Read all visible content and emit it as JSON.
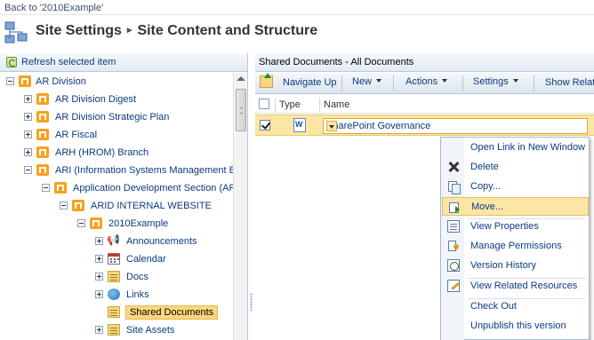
{
  "top_bar": {
    "back_link": "Back to '2010Example'"
  },
  "title": {
    "part1": "Site Settings",
    "separator": "▸",
    "part2": "Site Content and Structure"
  },
  "left_panel": {
    "refresh_label": "Refresh selected item",
    "tree": [
      {
        "label": "AR Division",
        "icon": "site-icon",
        "expander": "minus"
      },
      {
        "label": "AR Division Digest",
        "icon": "site-icon",
        "expander": "plus"
      },
      {
        "label": "AR Division Strategic Plan",
        "icon": "site-icon",
        "expander": "plus"
      },
      {
        "label": "AR Fiscal",
        "icon": "site-icon",
        "expander": "plus"
      },
      {
        "label": "ARH (HROM) Branch",
        "icon": "site-icon",
        "expander": "plus"
      },
      {
        "label": "ARI (Information Systems Management B",
        "icon": "site-icon",
        "expander": "minus"
      },
      {
        "label": "Application Development Section (AR",
        "icon": "site-icon",
        "expander": "minus"
      },
      {
        "label": "ARID INTERNAL WEBSITE",
        "icon": "site-icon",
        "expander": "minus"
      },
      {
        "label": "2010Example",
        "icon": "site-icon",
        "expander": "minus"
      },
      {
        "label": "Announcements",
        "icon": "megaphone-icon",
        "expander": "plus"
      },
      {
        "label": "Calendar",
        "icon": "calendar-icon",
        "expander": "plus"
      },
      {
        "label": "Docs",
        "icon": "folder-icon",
        "expander": "plus"
      },
      {
        "label": "Links",
        "icon": "globe-icon",
        "expander": "plus"
      },
      {
        "label": "Shared Documents",
        "icon": "folder-icon",
        "expander": "none",
        "selected": true
      },
      {
        "label": "Site Assets",
        "icon": "folder-icon",
        "expander": "plus"
      }
    ]
  },
  "right_panel": {
    "title": "Shared Documents - All Documents",
    "toolbar": {
      "navigate_up": "Navigate Up",
      "new": "New",
      "actions": "Actions",
      "settings": "Settings",
      "show_related": "Show Relat"
    },
    "columns": {
      "type": "Type",
      "name": "Name"
    },
    "selected_row": {
      "name": "SharePoint Governance",
      "icon": "word-doc-icon"
    }
  },
  "context_menu": {
    "items": [
      {
        "label": "Open Link in New Window",
        "icon": ""
      },
      {
        "label": "Delete",
        "icon": "x-icon"
      },
      {
        "label": "Copy...",
        "icon": "copy-icon"
      },
      {
        "label": "Move...",
        "icon": "move-icon",
        "highlighted": true
      },
      {
        "label": "View Properties",
        "icon": "props-icon"
      },
      {
        "label": "Manage Permissions",
        "icon": "perm-icon"
      },
      {
        "label": "Version History",
        "icon": "history-icon"
      },
      {
        "label": "View Related Resources",
        "icon": "edit-icon"
      },
      {
        "label": "Check Out",
        "icon": ""
      },
      {
        "label": "Unpublish this version",
        "icon": ""
      }
    ]
  },
  "colors": {
    "link": "#0c3a7e",
    "selection": "#fbe6a6",
    "selection_border": "#e6b74d",
    "site_icon": "#f7a21b"
  }
}
